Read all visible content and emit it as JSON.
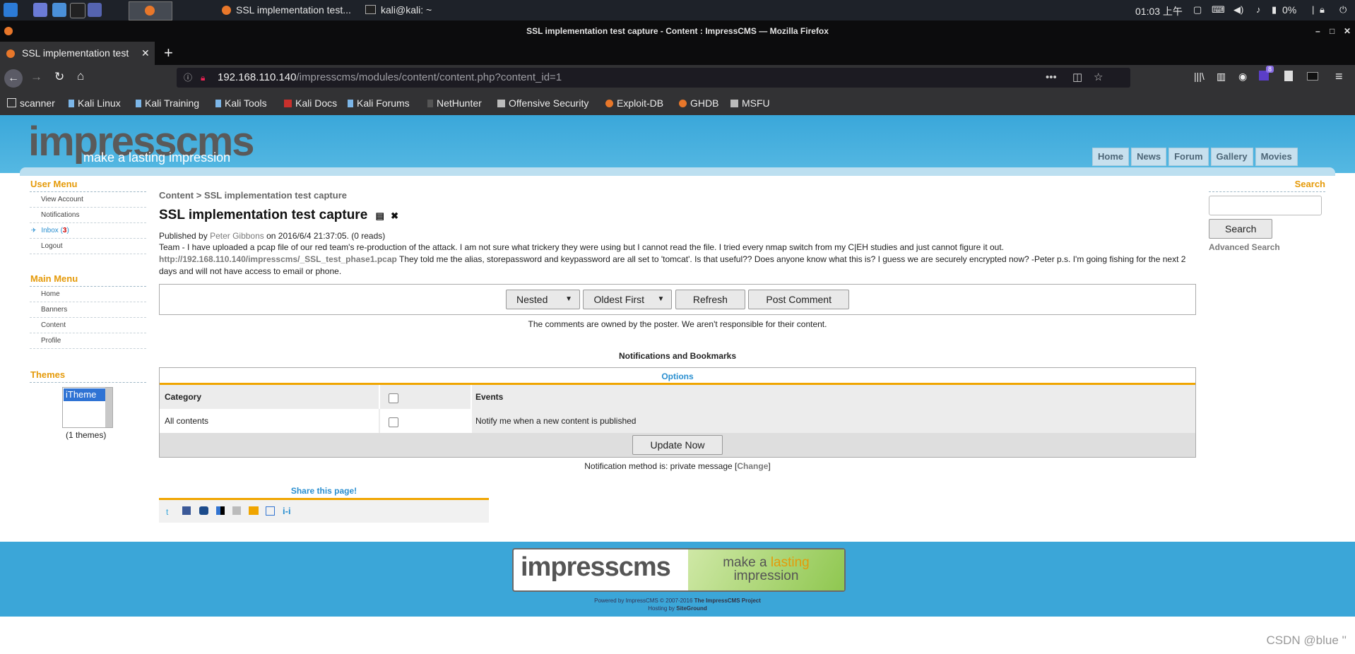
{
  "os_panel": {
    "tasks": [
      "SSL implementation test...",
      "kali@kali: ~"
    ],
    "clock": "01:03 上午",
    "battery": "0%"
  },
  "firefox": {
    "window_title": "SSL implementation test capture - Content : ImpressCMS — Mozilla Firefox",
    "tab_title": "SSL implementation test",
    "url_host": "192.168.110.140",
    "url_path": "/impresscms/modules/content/content.php?content_id=1",
    "bookmarks": [
      "scanner",
      "Kali Linux",
      "Kali Training",
      "Kali Tools",
      "Kali Docs",
      "Kali Forums",
      "NetHunter",
      "Offensive Security",
      "Exploit-DB",
      "GHDB",
      "MSFU"
    ],
    "extension_badge": "8"
  },
  "site": {
    "logo_text": "impresscms",
    "logo_tagline": "make a lasting impression",
    "nav": [
      "Home",
      "News",
      "Forum",
      "Gallery",
      "Movies"
    ]
  },
  "sidebar": {
    "user_menu_title": "User Menu",
    "user_items": [
      "View Account",
      "Notifications",
      "Inbox",
      "Logout"
    ],
    "inbox_count": "3",
    "main_menu_title": "Main Menu",
    "main_items": [
      "Home",
      "Banners",
      "Content",
      "Profile"
    ],
    "themes_title": "Themes",
    "theme_selected": "iTheme",
    "themes_count": "(1 themes)"
  },
  "content": {
    "breadcrumb_root": "Content",
    "breadcrumb_sep": ">",
    "breadcrumb_current": "SSL implementation test capture",
    "title": "SSL implementation test capture",
    "published_by": "Published by",
    "author": "Peter Gibbons",
    "published_on": "on 2016/6/4 21:37:05. (0 reads)",
    "body_part1": "Team - I have uploaded a pcap file of our red team's re-production of the attack. I am not sure what trickery they were using but I cannot read the file. I tried every nmap switch from my C|EH studies and just cannot figure it out.",
    "body_link": "http://192.168.110.140/impresscms/_SSL_test_phase1.pcap",
    "body_part2": "They told me the alias, storepassword and keypassword are all set to 'tomcat'. Is that useful?? Does anyone know what this is? I guess we are securely encrypted now? -Peter p.s. I'm going fishing for the next 2 days and will not have access to email or phone."
  },
  "comments": {
    "mode": "Nested",
    "order": "Oldest First",
    "refresh_label": "Refresh",
    "post_label": "Post Comment",
    "disclaimer": "The comments are owned by the poster. We aren't responsible for their content."
  },
  "notifications": {
    "heading": "Notifications and Bookmarks",
    "options_title": "Options",
    "col_category": "Category",
    "col_events": "Events",
    "row_category": "All contents",
    "row_event": "Notify me when a new content is published",
    "update_label": "Update Now",
    "method_text": "Notification method is: private message",
    "change_label": "Change"
  },
  "share": {
    "title": "Share this page!"
  },
  "search": {
    "title": "Search",
    "button_label": "Search",
    "advanced_label": "Advanced Search"
  },
  "footer": {
    "logo_left": "impresscms",
    "logo_right_1": "make a",
    "logo_right_lasting": "lasting",
    "logo_right_2": "impression",
    "powered": "Powered by ImpressCMS © 2007-2016",
    "project": "The ImpressCMS Project",
    "hosting": "Hosting by",
    "host": "SiteGround"
  },
  "watermark": "CSDN @blue ''"
}
